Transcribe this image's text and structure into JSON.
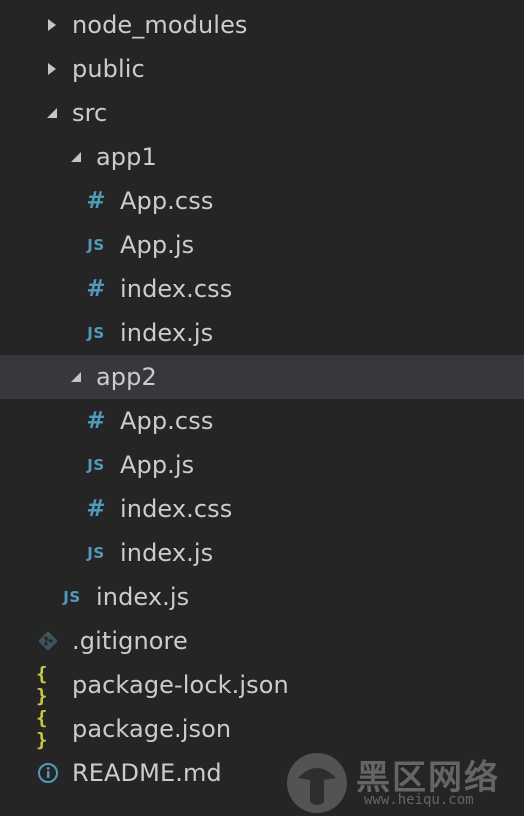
{
  "explorer": {
    "items": [
      {
        "label": "node_modules",
        "type": "folder",
        "state": "collapsed",
        "depth": 0,
        "icon": "chevron-right-icon"
      },
      {
        "label": "public",
        "type": "folder",
        "state": "collapsed",
        "depth": 0,
        "icon": "chevron-right-icon"
      },
      {
        "label": "src",
        "type": "folder",
        "state": "expanded",
        "depth": 0,
        "icon": "chevron-down-icon"
      },
      {
        "label": "app1",
        "type": "folder",
        "state": "expanded",
        "depth": 1,
        "icon": "chevron-down-icon"
      },
      {
        "label": "App.css",
        "type": "file",
        "depth": 2,
        "icon": "css-file-icon",
        "icon_glyph": "#"
      },
      {
        "label": "App.js",
        "type": "file",
        "depth": 2,
        "icon": "js-file-icon",
        "icon_glyph": "JS"
      },
      {
        "label": "index.css",
        "type": "file",
        "depth": 2,
        "icon": "css-file-icon",
        "icon_glyph": "#"
      },
      {
        "label": "index.js",
        "type": "file",
        "depth": 2,
        "icon": "js-file-icon",
        "icon_glyph": "JS"
      },
      {
        "label": "app2",
        "type": "folder",
        "state": "expanded",
        "depth": 1,
        "icon": "chevron-down-icon",
        "selected": true
      },
      {
        "label": "App.css",
        "type": "file",
        "depth": 2,
        "icon": "css-file-icon",
        "icon_glyph": "#"
      },
      {
        "label": "App.js",
        "type": "file",
        "depth": 2,
        "icon": "js-file-icon",
        "icon_glyph": "JS"
      },
      {
        "label": "index.css",
        "type": "file",
        "depth": 2,
        "icon": "css-file-icon",
        "icon_glyph": "#"
      },
      {
        "label": "index.js",
        "type": "file",
        "depth": 2,
        "icon": "js-file-icon",
        "icon_glyph": "JS"
      },
      {
        "label": "index.js",
        "type": "file",
        "depth": 1,
        "icon": "js-file-icon",
        "icon_glyph": "JS"
      },
      {
        "label": ".gitignore",
        "type": "file",
        "depth": 0,
        "icon": "git-file-icon"
      },
      {
        "label": "package-lock.json",
        "type": "file",
        "depth": 0,
        "icon": "json-file-icon",
        "icon_glyph": "{ }"
      },
      {
        "label": "package.json",
        "type": "file",
        "depth": 0,
        "icon": "json-file-icon",
        "icon_glyph": "{ }"
      },
      {
        "label": "README.md",
        "type": "file",
        "depth": 0,
        "icon": "info-file-icon"
      }
    ]
  },
  "watermark": {
    "title": "黑区网络",
    "url": "www.heiqu.com"
  },
  "colors": {
    "background": "#252526",
    "selected_row": "#37373d",
    "text": "#cccccc",
    "css_js_icon": "#519aba",
    "json_icon": "#cbcb41",
    "git_icon": "#41535b",
    "info_icon": "#519aba"
  }
}
